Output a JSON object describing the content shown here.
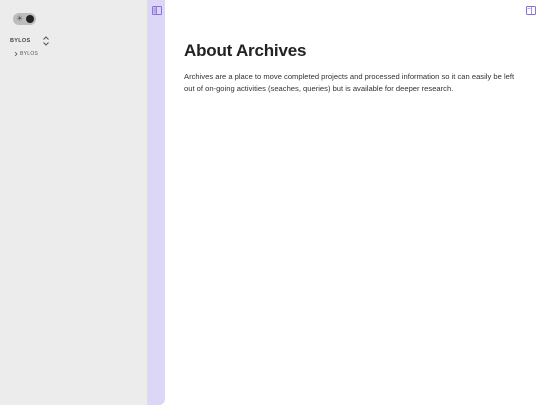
{
  "theme_toggle": {
    "light_icon": "sun-icon",
    "dark_state": "dark-knob"
  },
  "sidebar": {
    "vault_name": "BYLOS",
    "tree": [
      {
        "label": "BYLOS",
        "icon": "chevron-right-icon"
      }
    ]
  },
  "colors": {
    "ribbon": "#dcd6f7",
    "accent": "#8b6fe0",
    "sidebar_bg": "#ececec"
  },
  "main": {
    "title": "About Archives",
    "body": "Archives are a place to move completed projects and processed information so it can easily be left out of on-going activities (seaches, queries) but is available for deeper research."
  }
}
